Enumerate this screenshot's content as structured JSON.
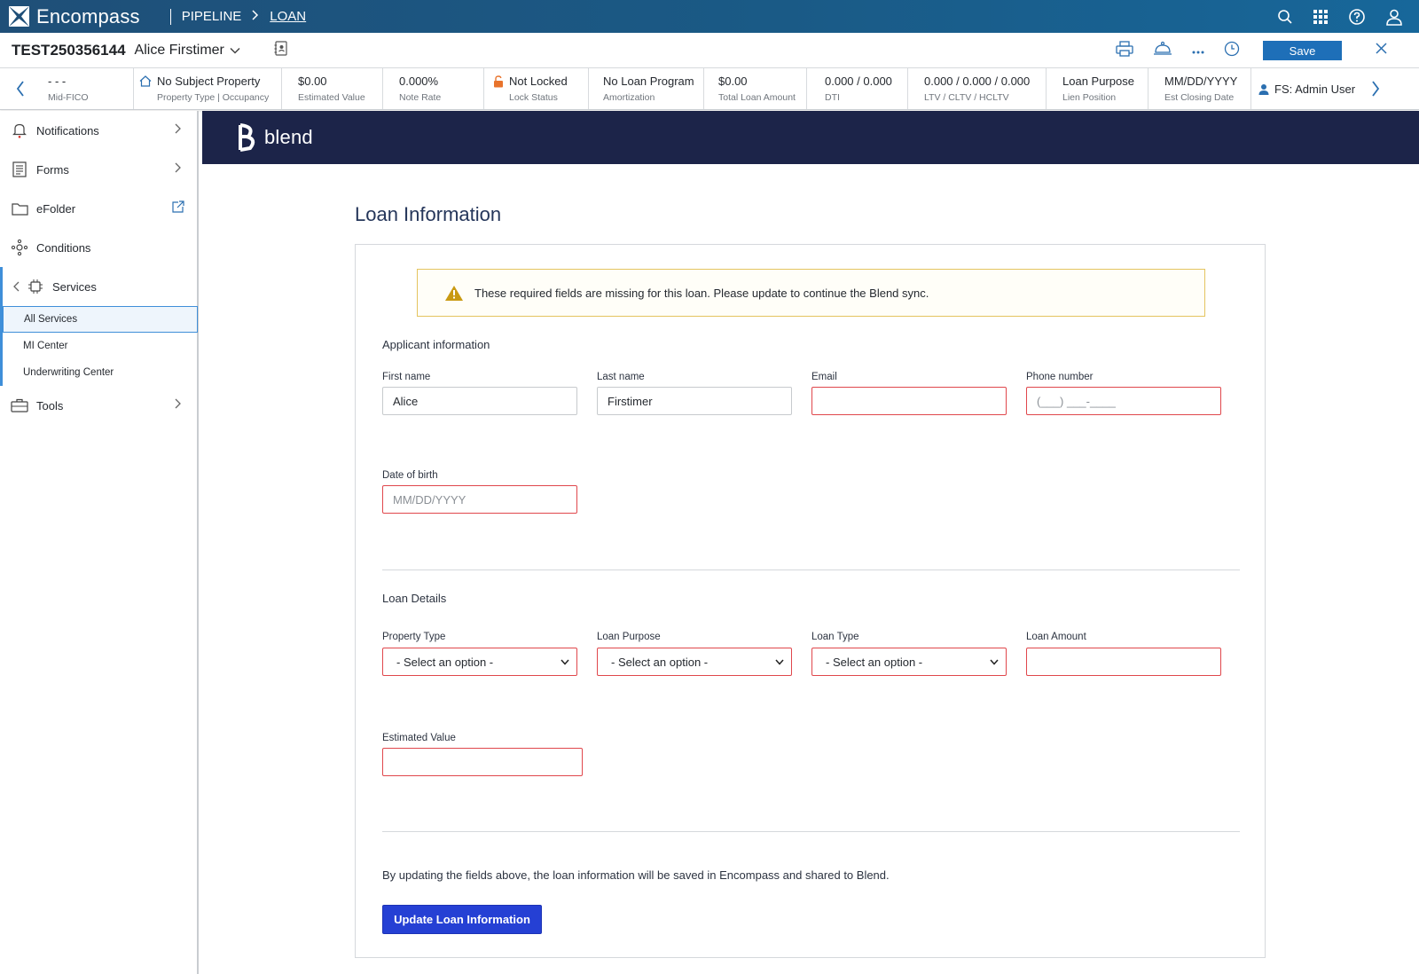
{
  "app": {
    "name": "Encompass",
    "breadcrumb": [
      "PIPELINE",
      "LOAN"
    ]
  },
  "loan_header": {
    "loan_number": "TEST250356144",
    "borrower_name": "Alice Firstimer",
    "save_label": "Save"
  },
  "summary": [
    {
      "value": "- - -",
      "label": "Mid-FICO"
    },
    {
      "value": "No Subject Property",
      "label": "Property Type | Occupancy",
      "icon": "home-icon"
    },
    {
      "value": "$0.00",
      "label": "Estimated Value"
    },
    {
      "value": "0.000%",
      "label": "Note Rate"
    },
    {
      "value": "Not Locked",
      "label": "Lock Status",
      "icon": "unlocked-icon"
    },
    {
      "value": "No Loan Program",
      "label": "Amortization"
    },
    {
      "value": "$0.00",
      "label": "Total Loan Amount"
    },
    {
      "value": "0.000 / 0.000",
      "label": "DTI"
    },
    {
      "value": "0.000 / 0.000 / 0.000",
      "label": "LTV / CLTV / HCLTV"
    },
    {
      "value": "Loan Purpose",
      "label": "Lien Position"
    },
    {
      "value": "MM/DD/YYYY",
      "label": "Est Closing Date"
    }
  ],
  "summary_user": "FS: Admin User",
  "sidenav": {
    "items": [
      {
        "label": "Notifications",
        "icon": "bell-icon"
      },
      {
        "label": "Forms",
        "icon": "form-icon"
      },
      {
        "label": "eFolder",
        "icon": "folder-icon"
      },
      {
        "label": "Conditions",
        "icon": "conditions-icon"
      },
      {
        "label": "Services",
        "icon": "chip-icon"
      },
      {
        "label": "Tools",
        "icon": "toolbox-icon"
      }
    ],
    "services_sub": [
      "All Services",
      "MI Center",
      "Underwriting Center"
    ]
  },
  "blend": {
    "logo_text": "blend",
    "page_title": "Loan Information",
    "alert": "These required fields are missing for this loan. Please update to continue the Blend sync.",
    "applicant_section": "Applicant information",
    "fields": {
      "first_name": {
        "label": "First name",
        "value": "Alice"
      },
      "last_name": {
        "label": "Last name",
        "value": "Firstimer"
      },
      "email": {
        "label": "Email",
        "value": ""
      },
      "phone": {
        "label": "Phone number",
        "placeholder": "(___) ___-____"
      },
      "dob": {
        "label": "Date of birth",
        "placeholder": "MM/DD/YYYY"
      }
    },
    "loan_section": "Loan Details",
    "loan_fields": {
      "property_type": {
        "label": "Property Type",
        "value": "- Select an option -"
      },
      "loan_purpose": {
        "label": "Loan Purpose",
        "value": "- Select an option -"
      },
      "loan_type": {
        "label": "Loan Type",
        "value": "- Select an option -"
      },
      "loan_amount": {
        "label": "Loan Amount",
        "value": ""
      },
      "estimated_value": {
        "label": "Estimated Value",
        "value": ""
      }
    },
    "footnote": "By updating the fields above, the loan information will be saved in Encompass and shared to Blend.",
    "update_button": "Update Loan Information"
  },
  "colors": {
    "top_bar": "#1a5a86",
    "blend_header": "#1c2449",
    "error_border": "#e0474c",
    "primary_button": "#2540d4",
    "save_button": "#1e6fb8",
    "alert_border": "#e4c45f"
  }
}
